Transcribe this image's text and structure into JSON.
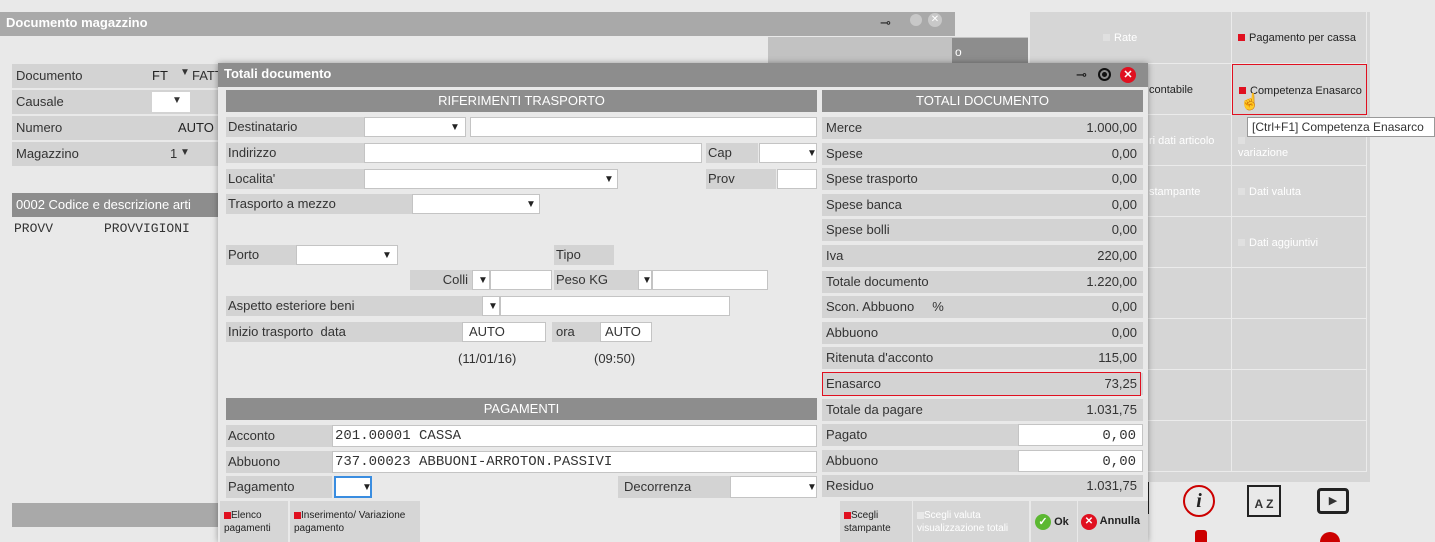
{
  "back_window": {
    "title": "Documento magazzino",
    "fields": [
      {
        "label": "Documento",
        "value": "FT",
        "extra": "FATT"
      },
      {
        "label": "Causale",
        "value": ""
      },
      {
        "label": "Numero",
        "value": "AUTO"
      },
      {
        "label": "Magazzino",
        "value": "1"
      }
    ],
    "grid_header": "0002   Codice e descrizione arti",
    "grid_row": {
      "code": "PROVV",
      "desc": "PROVVIGIONI"
    },
    "top_right_fragment": "o"
  },
  "right_panel": {
    "col1": [
      "Rate",
      "contabile",
      "ri dati articolo",
      "stampante",
      ""
    ],
    "col2": [
      "Pagamento per cassa",
      "Competenza Enasarco",
      "variazione",
      "Dati valuta",
      "Dati aggiuntivi"
    ],
    "tooltip": "[Ctrl+F1] Competenza Enasarco"
  },
  "dialog": {
    "title": "Totali documento",
    "riferimenti": {
      "header": "RIFERIMENTI TRASPORTO",
      "destinatario": "Destinatario",
      "indirizzo": "Indirizzo",
      "cap": "Cap",
      "localita": "Localita'",
      "prov": "Prov",
      "trasporto": "Trasporto a mezzo",
      "porto": "Porto",
      "tipo": "Tipo",
      "colli": "Colli",
      "peso": "Peso KG",
      "aspetto": "Aspetto esteriore beni",
      "inizio": "Inizio trasporto",
      "data_label": "data",
      "data_value": "AUTO",
      "ora_label": "ora",
      "ora_value": "AUTO",
      "data_hint": "(11/01/16)",
      "ora_hint": "(09:50)"
    },
    "pagamenti": {
      "header": "PAGAMENTI",
      "acconto_label": "Acconto",
      "acconto_value": "201.00001 CASSA",
      "abbuono_label": "Abbuono",
      "abbuono_value": "737.00023 ABBUONI-ARROTON.PASSIVI",
      "pagamento_label": "Pagamento",
      "decorrenza_label": "Decorrenza"
    },
    "totali": {
      "header": "TOTALI DOCUMENTO",
      "rows": [
        {
          "label": "Merce",
          "value": "1.000,00"
        },
        {
          "label": "Spese",
          "value": "0,00"
        },
        {
          "label": "Spese trasporto",
          "value": "0,00"
        },
        {
          "label": "Spese banca",
          "value": "0,00"
        },
        {
          "label": "Spese bolli",
          "value": "0,00"
        },
        {
          "label": "Iva",
          "value": "220,00"
        },
        {
          "label": "Totale documento",
          "value": "1.220,00"
        },
        {
          "label": "Scon. Abbuono     %",
          "value": "0,00"
        },
        {
          "label": "Abbuono",
          "value": "0,00"
        },
        {
          "label": "Ritenuta d'acconto",
          "value": "115,00"
        },
        {
          "label": "Enasarco",
          "value": "73,25"
        },
        {
          "label": "Totale da pagare",
          "value": "1.031,75"
        },
        {
          "label": "Pagato",
          "value": "0,00"
        },
        {
          "label": "Abbuono",
          "value": "0,00"
        },
        {
          "label": "Residuo",
          "value": "1.031,75"
        }
      ]
    },
    "buttons": {
      "elenco": "Elenco pagamenti",
      "inserimento": "Inserimento/ Variazione pagamento",
      "scegli_stampante": "Scegli stampante",
      "scegli_valuta": "Scegli valuta visualizzazione totali",
      "ok": "Ok",
      "annulla": "Annulla"
    }
  },
  "colors": {
    "accent_red": "#e01020",
    "title_gray": "#8d8d8d",
    "ok_green": "#5cb832"
  }
}
